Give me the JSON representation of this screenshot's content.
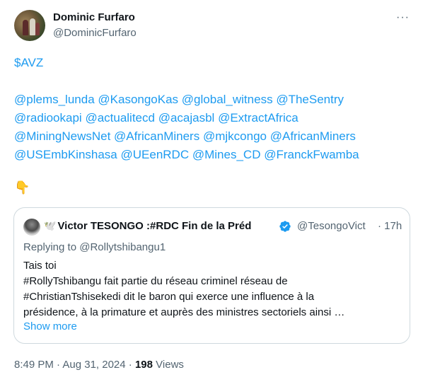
{
  "author": {
    "name": "Dominic Furfaro",
    "handle": "@DominicFurfaro"
  },
  "more_glyph": "···",
  "tweet": {
    "cashtag": "$AVZ",
    "mentions_line1": [
      "@plems_lunda",
      "@KasongoKas",
      "@global_witness",
      "@TheSentry"
    ],
    "mentions_line2": [
      "@radiookapi",
      "@actualitecd",
      "@acajasbl",
      "@ExtractAfrica"
    ],
    "mentions_line3": [
      "@MiningNewsNet",
      "@AfricanMiners",
      "@mjkcongo",
      "@AfricanMiners"
    ],
    "mentions_line4": [
      "@USEmbKinshasa",
      "@UEenRDC",
      "@Mines_CD",
      "@FranckFwamba"
    ],
    "emoji": "👇"
  },
  "quote": {
    "dove": "🕊️",
    "name": "Victor TESONGO :#RDC Fin de la Préd",
    "handle": "@TesongoVict",
    "time": "· 17h",
    "replying_to": "Replying to @Rollytshibangu1",
    "lines": [
      "Tais toi",
      "#RollyTshibangu fait partie du réseau criminel réseau de",
      "#ChristianTshisekedi dit le baron qui exerce une influence à la",
      "présidence, à la primature et auprès des ministres sectoriels ainsi …"
    ],
    "show_more": "Show more"
  },
  "meta": {
    "timestamp": "8:49 PM · Aug 31, 2024 ·",
    "views_count": "198",
    "views_label": "Views"
  },
  "colors": {
    "link": "#1d9bf0",
    "text": "#0f1419",
    "secondary": "#536471",
    "border": "#cfd9de"
  },
  "icons": [
    "more-icon",
    "verified-badge-icon"
  ]
}
